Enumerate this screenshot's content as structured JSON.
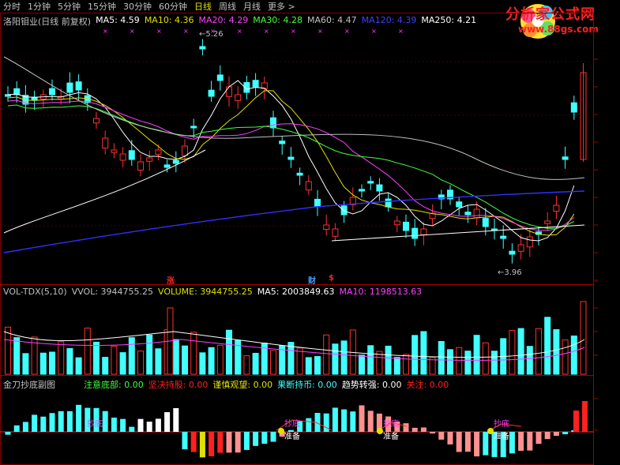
{
  "toolbar": {
    "tabs": [
      {
        "label": "分时",
        "active": false
      },
      {
        "label": "1分钟",
        "active": false
      },
      {
        "label": "5分钟",
        "active": false
      },
      {
        "label": "15分钟",
        "active": false
      },
      {
        "label": "30分钟",
        "active": false
      },
      {
        "label": "60分钟",
        "active": false
      },
      {
        "label": "日线",
        "active": true
      },
      {
        "label": "周线",
        "active": false
      },
      {
        "label": "月线",
        "active": false
      },
      {
        "label": "更多 >",
        "active": false
      }
    ]
  },
  "logo": {
    "name": "分析家公式网",
    "url": "www.88gs.com",
    "icon": "flower-logo"
  },
  "price_panel": {
    "title": "洛阳钼业(日线 前复权)",
    "ma": [
      {
        "label": "MA5: 4.59",
        "color": "#ffffff"
      },
      {
        "label": "MA10: 4.36",
        "color": "#e0e000"
      },
      {
        "label": "MA20: 4.29",
        "color": "#ff40ff"
      },
      {
        "label": "MA30: 4.28",
        "color": "#40ff40"
      },
      {
        "label": "MA60: 4.47",
        "color": "#c0c0c0"
      },
      {
        "label": "MA120: 4.39",
        "color": "#4040ff"
      },
      {
        "label": "MA250: 4.21",
        "color": "#ffffff"
      }
    ],
    "high_label": "5.26",
    "low_label": "3.96",
    "event_marks": [
      {
        "text": "涨",
        "color": "#ff2020"
      },
      {
        "text": "财",
        "color": "#40a0ff"
      },
      {
        "text": "$",
        "color": "#ff2020"
      }
    ]
  },
  "volume_panel": {
    "title": "VOL-TDX(5,10)",
    "items": [
      {
        "label": "VVOL: 3944755.25",
        "color": "#c0c0c0"
      },
      {
        "label": "VOLUME: 3944755.25",
        "color": "#e0e000"
      },
      {
        "label": "MA5: 2003849.63",
        "color": "#ffffff"
      },
      {
        "label": "MA10: 1198513.63",
        "color": "#ff40ff"
      }
    ]
  },
  "indicator_panel": {
    "title": "金刀抄底副图",
    "items": [
      {
        "label": "注意底部: 0.00",
        "color": "#40ff40"
      },
      {
        "label": "坚决持股: 0.00",
        "color": "#ff2020"
      },
      {
        "label": "谨慎观望: 0.00",
        "color": "#e0e000"
      },
      {
        "label": "果断持币: 0.00",
        "color": "#40ffff"
      },
      {
        "label": "趋势转强: 0.00",
        "color": "#ffffff"
      },
      {
        "label": "关注: 0.00",
        "color": "#ff2020"
      }
    ],
    "signal_labels": [
      "抄底",
      "准备"
    ]
  }
}
